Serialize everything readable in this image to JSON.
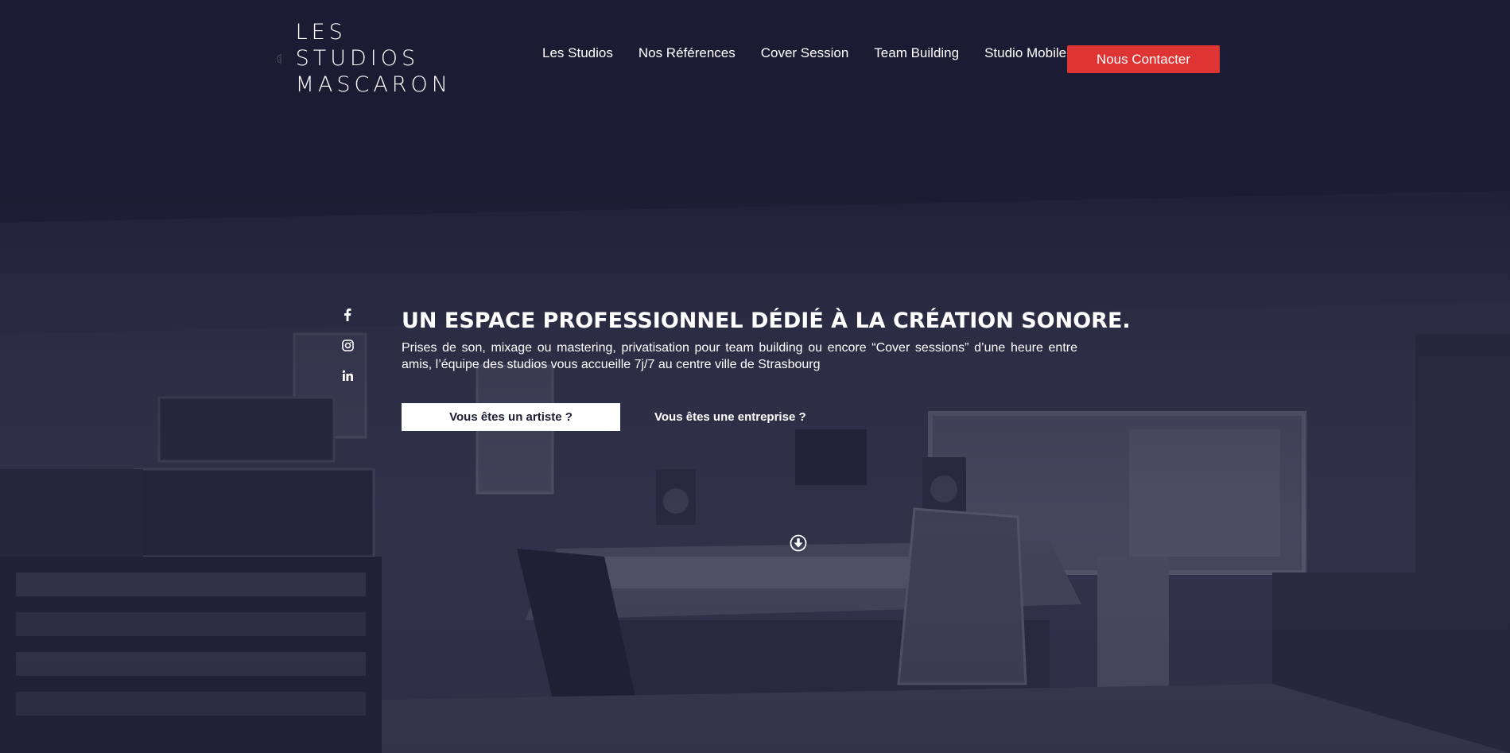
{
  "brand": {
    "name_lines": [
      "LES",
      "STUDIOS",
      "MASCARON"
    ]
  },
  "nav": {
    "items": [
      "Les Studios",
      "Nos Références",
      "Cover Session",
      "Team Building",
      "Studio Mobile"
    ],
    "contact_label": "Nous Contacter"
  },
  "social": [
    "facebook-icon",
    "instagram-icon",
    "linkedin-icon"
  ],
  "hero": {
    "title": "UN ESPACE PROFESSIONNEL DÉDIÉ À LA CRÉATION SONORE.",
    "subtitle": "Prises de son, mixage ou mastering, privatisation pour team building ou encore “Cover sessions” d’une heure entre amis, l’équipe des studios vous accueille 7j/7 au centre ville de Strasbourg",
    "artist_button": "Vous êtes un artiste ?",
    "business_link": "Vous êtes une entreprise ?"
  },
  "colors": {
    "background": "#1c1d34",
    "accent": "#de3434",
    "text": "#ffffff"
  }
}
